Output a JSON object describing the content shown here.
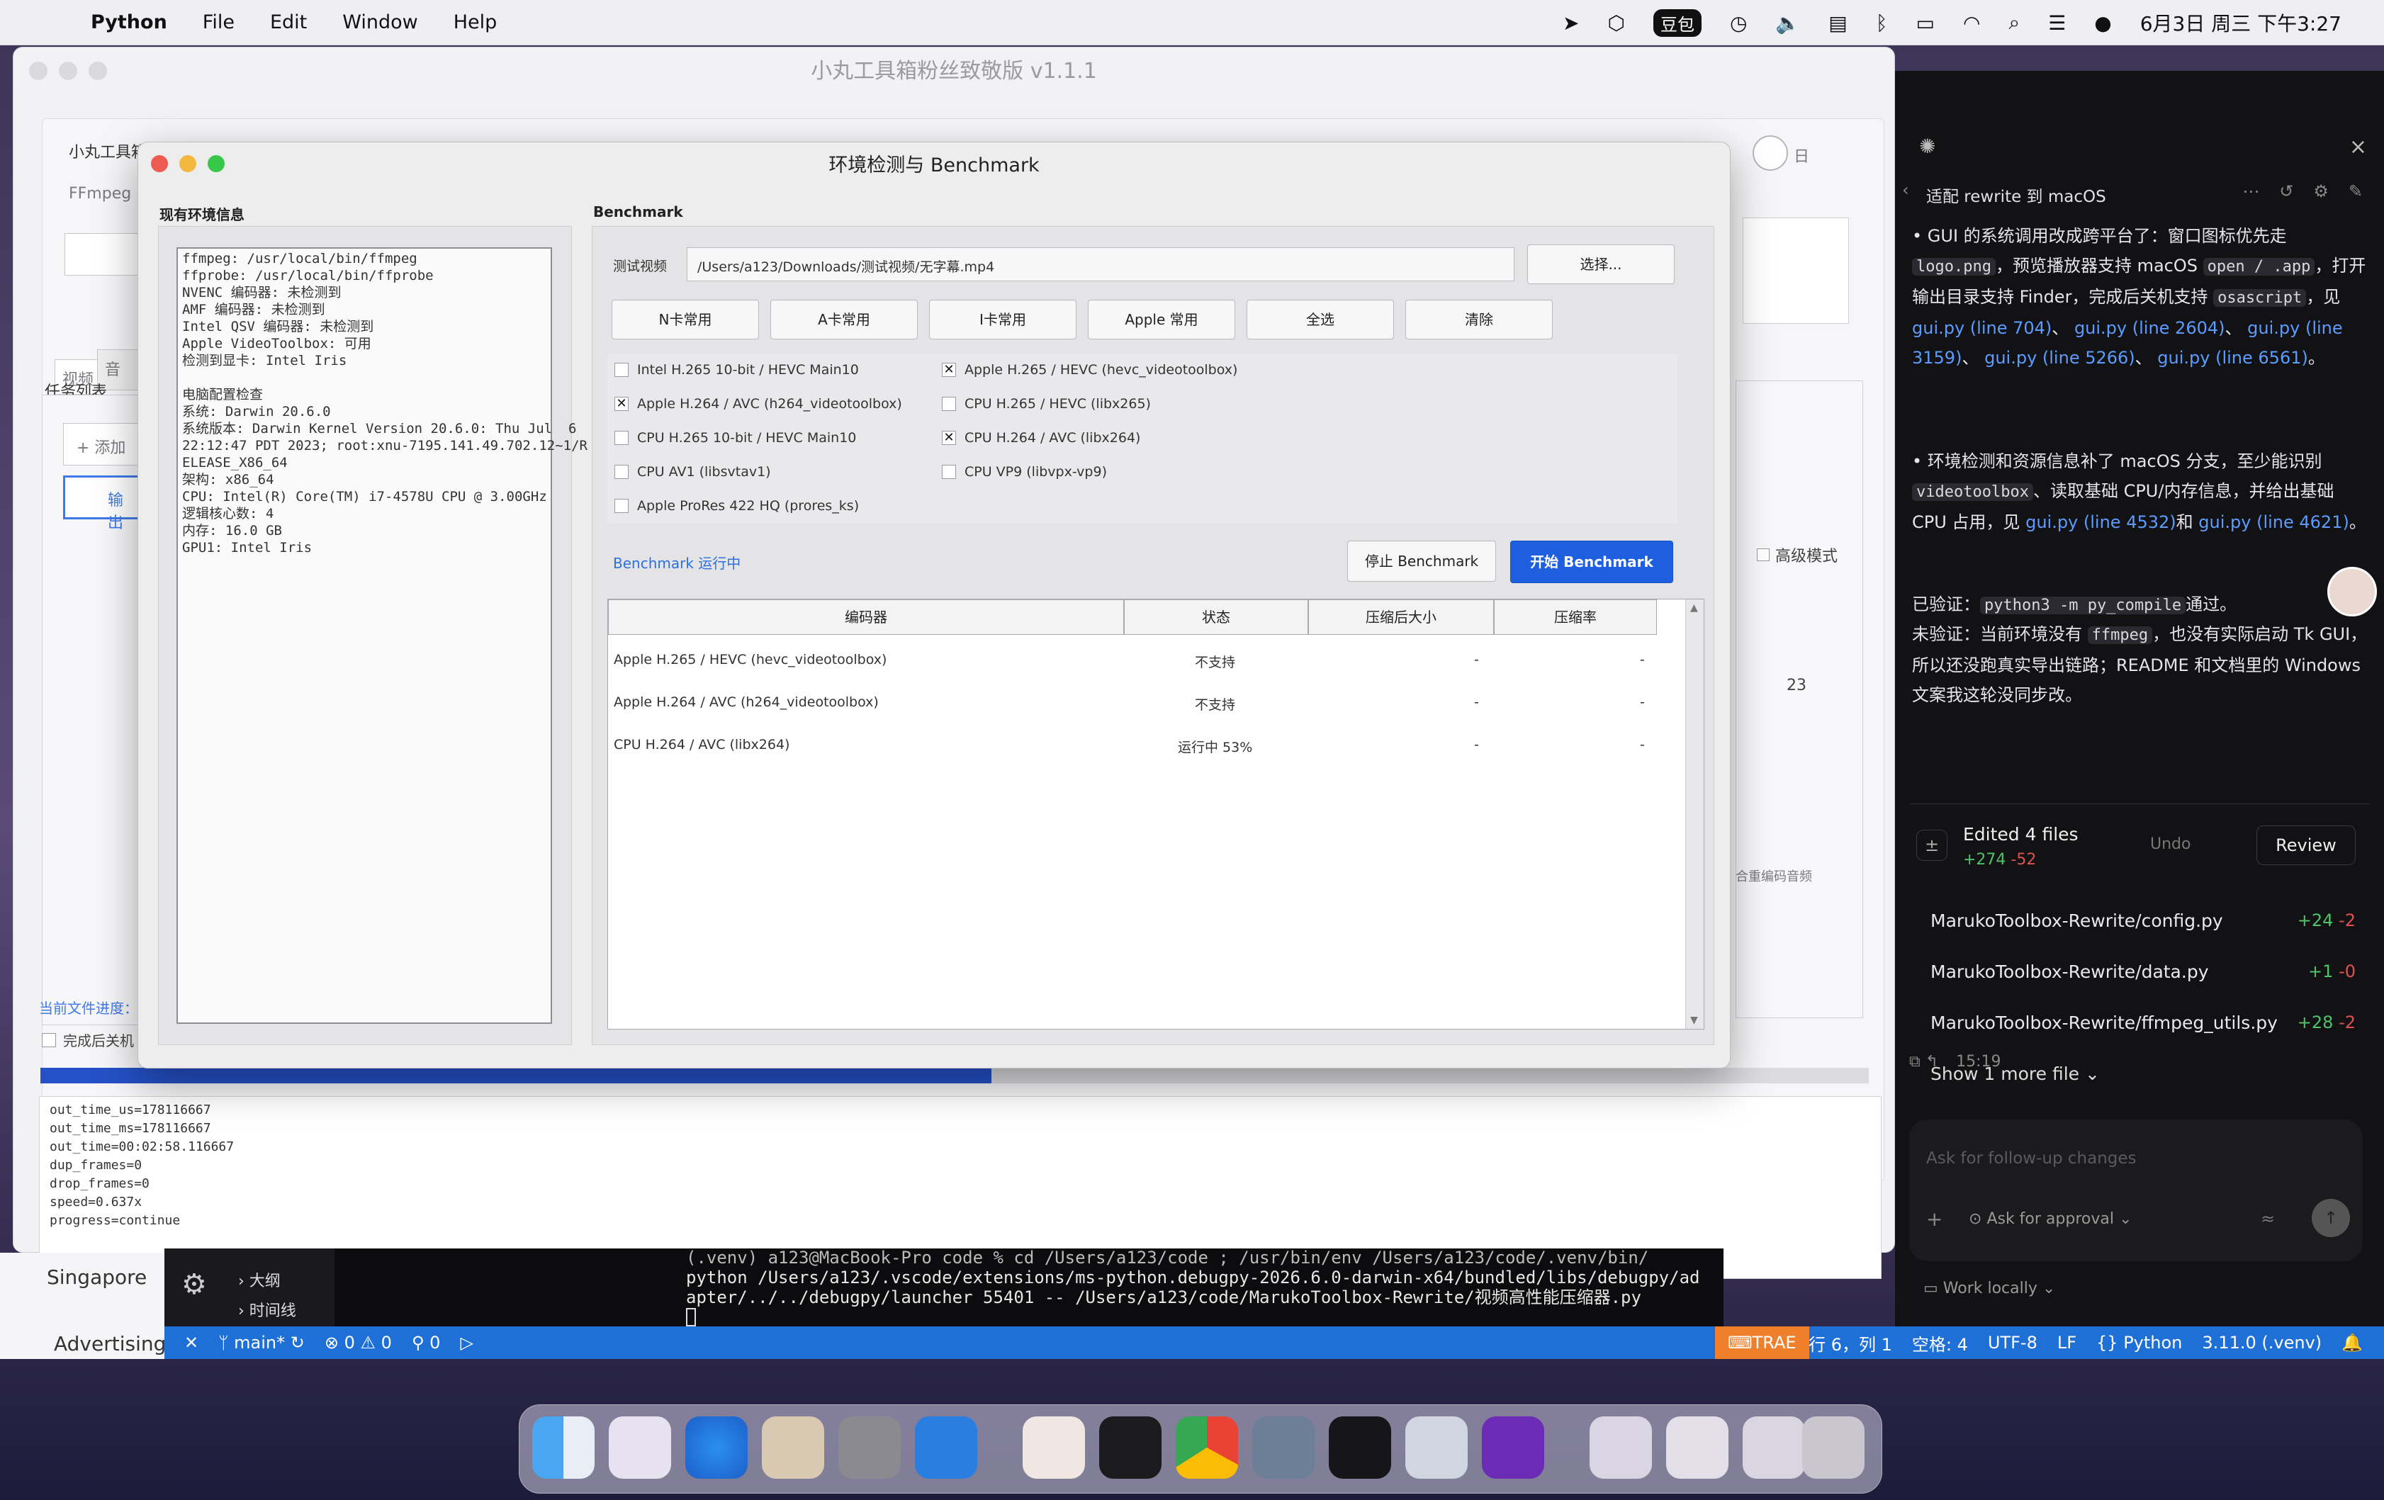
{
  "menubar": {
    "app": "Python",
    "items": [
      "File",
      "Edit",
      "Window",
      "Help"
    ],
    "ime": "豆包",
    "clock": "6月3日 周三 下午3:27"
  },
  "app_window": {
    "title": "小丸工具箱粉丝致敬版   v1.1.1",
    "sidebar_title": "小丸工具箱粉丝致敬版",
    "ffmpeg_label": "FFmpeg +",
    "tab_video": "视频",
    "tab_audio": "音",
    "task_list": "任务列表",
    "add_btn": "+ 添加",
    "output_btn": "输出",
    "current_progress": "当前文件进度：",
    "shutdown_after": "完成后关机",
    "advanced_mode": "高级模式",
    "value_23": "23",
    "keep_audio": "合重编码音频",
    "toggle_label": "日",
    "progress": 0.52,
    "log_lines": [
      "out_time_us=178116667",
      "out_time_ms=178116667",
      "out_time=00:02:58.116667",
      "dup_frames=0",
      "drop_frames=0",
      "speed=0.637x",
      "progress=continue"
    ]
  },
  "dialog": {
    "title": "环境检测与 Benchmark",
    "env_section": "现有环境信息",
    "env_text": "ffmpeg: /usr/local/bin/ffmpeg\nffprobe: /usr/local/bin/ffprobe\nNVENC 编码器: 未检测到\nAMF 编码器: 未检测到\nIntel QSV 编码器: 未检测到\nApple VideoToolbox: 可用\n检测到显卡: Intel Iris\n\n电脑配置检查\n系统: Darwin 20.6.0\n系统版本: Darwin Kernel Version 20.6.0: Thu Jul  6\n22:12:47 PDT 2023; root:xnu-7195.141.49.702.12~1/R\nELEASE_X86_64\n架构: x86_64\nCPU: Intel(R) Core(TM) i7-4578U CPU @ 3.00GHz\n逻辑核心数: 4\n内存: 16.0 GB\nGPU1: Intel Iris",
    "bench_section": "Benchmark",
    "test_video_label": "测试视频",
    "test_video_path": "/Users/a123/Downloads/测试视频/无字幕.mp4",
    "choose_btn": "选择...",
    "preset_buttons": [
      "N卡常用",
      "A卡常用",
      "I卡常用",
      "Apple 常用",
      "全选",
      "清除"
    ],
    "encoders_left": [
      {
        "label": "Intel H.265 10-bit / HEVC Main10",
        "checked": false
      },
      {
        "label": "Apple H.264 / AVC (h264_videotoolbox)",
        "checked": true
      },
      {
        "label": "CPU H.265 10-bit / HEVC Main10",
        "checked": false
      },
      {
        "label": "CPU AV1 (libsvtav1)",
        "checked": false
      },
      {
        "label": "Apple ProRes 422 HQ (prores_ks)",
        "checked": false
      }
    ],
    "encoders_right": [
      {
        "label": "Apple H.265 / HEVC (hevc_videotoolbox)",
        "checked": true
      },
      {
        "label": "CPU H.265 / HEVC (libx265)",
        "checked": false
      },
      {
        "label": "CPU H.264 / AVC (libx264)",
        "checked": true
      },
      {
        "label": "CPU VP9 (libvpx-vp9)",
        "checked": false
      }
    ],
    "running_status": "Benchmark 运行中",
    "stop_btn": "停止 Benchmark",
    "start_btn": "开始 Benchmark",
    "table_headers": [
      "编码器",
      "状态",
      "压缩后大小",
      "压缩率"
    ],
    "table_rows": [
      [
        "Apple H.265 / HEVC (hevc_videotoolbox)",
        "不支持",
        "-",
        "-"
      ],
      [
        "Apple H.264 / AVC (h264_videotoolbox)",
        "不支持",
        "-",
        "-"
      ],
      [
        "CPU H.264 / AVC (libx264)",
        "运行中 53%",
        "-",
        "-"
      ]
    ]
  },
  "chat": {
    "header": "适配 rewrite 到 macOS",
    "bullet1": [
      "GUI 的系统调用改成跨平台了：窗口图标优先走",
      "logo.png",
      "，预览播放器支持 macOS",
      "open / .app",
      "，打开输出目录支持 Finder，完成后关机支持",
      "osascript",
      "，见",
      "gui.py (line 704)",
      "、",
      "gui.py (line 2604)",
      "、",
      "gui.py (line 3159)",
      "、",
      "gui.py (line 5266)",
      "、",
      "gui.py (line 6561)",
      "。"
    ],
    "bullet2": [
      "环境检测和资源信息补了 macOS 分支，至少能识别",
      "videotoolbox",
      "、读取基础 CPU/内存信息，并给出基础 CPU 占用，见",
      "gui.py (line 4532)",
      "和",
      "gui.py (line 4621)",
      "。"
    ],
    "verified": [
      "已验证：",
      "python3 -m py_compile",
      "通过。"
    ],
    "unverified": [
      "未验证：当前环境没有",
      "ffmpeg",
      "，也没有实际启动 Tk GUI，所以还没跑真实导出链路；README 和文档里的 Windows 文案我这轮没同步改。"
    ],
    "edited_files": "Edited 4 files",
    "edited_plus": "+274",
    "edited_minus": "-52",
    "undo": "Undo",
    "review": "Review",
    "files": [
      {
        "name": "MarukoToolbox-Rewrite/config.py",
        "plus": "+24",
        "minus": "-2"
      },
      {
        "name": "MarukoToolbox-Rewrite/data.py",
        "plus": "+1",
        "minus": "-0"
      },
      {
        "name": "MarukoToolbox-Rewrite/ffmpeg_utils.py",
        "plus": "+28",
        "minus": "-2"
      }
    ],
    "show_more": "Show 1 more file",
    "time": "15:19",
    "input_placeholder": "Ask for follow-up changes",
    "approval": "Ask for approval",
    "work_locally": "Work locally"
  },
  "terminal": {
    "line1": "(.venv) a123@MacBook-Pro code % cd /Users/a123/code ; /usr/bin/env /Users/a123/code/.venv/bin/",
    "line2": "python /Users/a123/.vscode/extensions/ms-python.debugpy-2026.6.0-darwin-x64/bundled/libs/debugpy/ad",
    "line3": "apter/../../debugpy/launcher 55401 -- /Users/a123/code/MarukoToolbox-Rewrite/视频高性能压缩器.py"
  },
  "left_pane": {
    "location": "Singapore",
    "advertising": "Advertising",
    "outline": "大纲",
    "timeline": "时间线"
  },
  "statusbar": {
    "branch": "main*",
    "errors": "0",
    "warnings": "0",
    "ports": "0",
    "trae": "TRAE",
    "position": "行 6，列 1",
    "spaces": "空格: 4",
    "encoding": "UTF-8",
    "eol": "LF",
    "language": "Python",
    "interpreter": "3.11.0 (.venv)"
  },
  "colors": {
    "accent": "#1e5fe0",
    "status_bar": "#1e6fd6",
    "chat_bg": "#121214",
    "link": "#5c9cff"
  }
}
